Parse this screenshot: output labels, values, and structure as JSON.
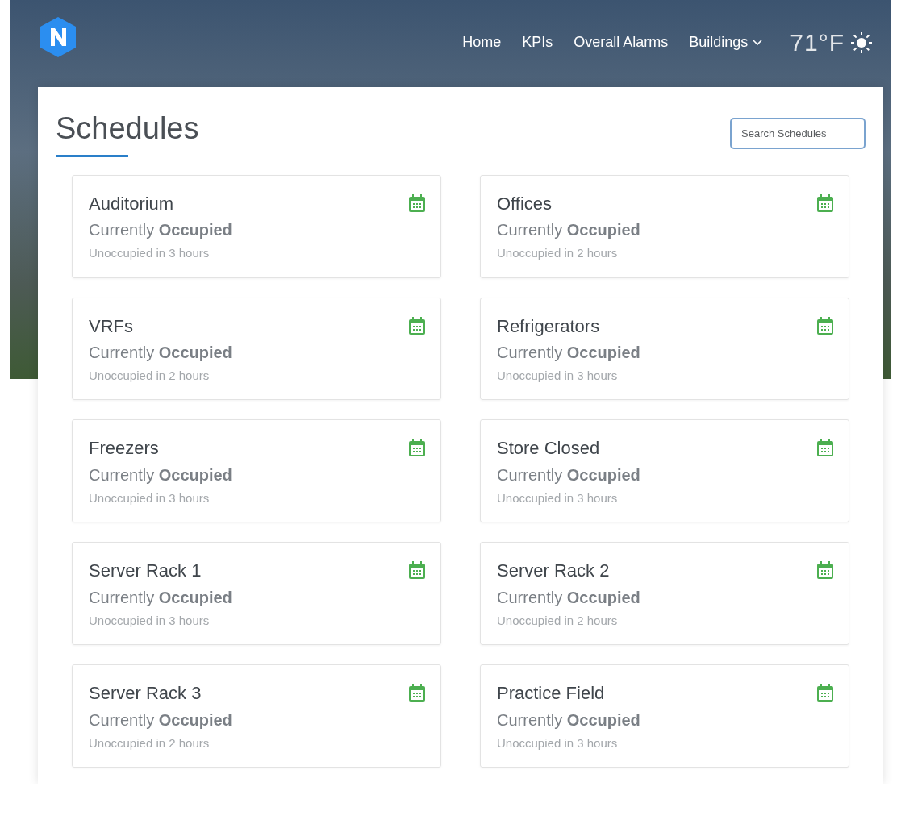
{
  "nav": {
    "items": [
      {
        "label": "Home"
      },
      {
        "label": "KPIs"
      },
      {
        "label": "Overall Alarms"
      },
      {
        "label": "Buildings",
        "dropdown": true
      }
    ],
    "weather": {
      "temperature": "71°F"
    }
  },
  "page": {
    "title": "Schedules",
    "search": {
      "placeholder": "Search Schedules"
    }
  },
  "schedules": [
    {
      "name": "Auditorium",
      "status": "Currently **Occupied**",
      "next": "Unoccupied in 3 hours"
    },
    {
      "name": "Offices",
      "status": "Currently **Occupied**",
      "next": "Unoccupied in 2 hours"
    },
    {
      "name": "VRFs",
      "status": "Currently **Occupied**",
      "next": "Unoccupied in 2 hours"
    },
    {
      "name": "Refrigerators",
      "status": "Currently **Occupied**",
      "next": "Unoccupied in 3 hours"
    },
    {
      "name": "Freezers",
      "status": "Currently **Occupied**",
      "next": "Unoccupied in 3 hours"
    },
    {
      "name": "Store Closed",
      "status": "Currently **Occupied**",
      "next": "Unoccupied in 3 hours"
    },
    {
      "name": "Server Rack 1",
      "status": "Currently **Occupied**",
      "next": "Unoccupied in 3 hours"
    },
    {
      "name": "Server Rack 2",
      "status": "Currently **Occupied**",
      "next": "Unoccupied in 2 hours"
    },
    {
      "name": "Server Rack 3",
      "status": "Currently **Occupied**",
      "next": "Unoccupied in 2 hours"
    },
    {
      "name": "Practice Field",
      "status": "Currently **Occupied**",
      "next": "Unoccupied in 3 hours"
    }
  ]
}
